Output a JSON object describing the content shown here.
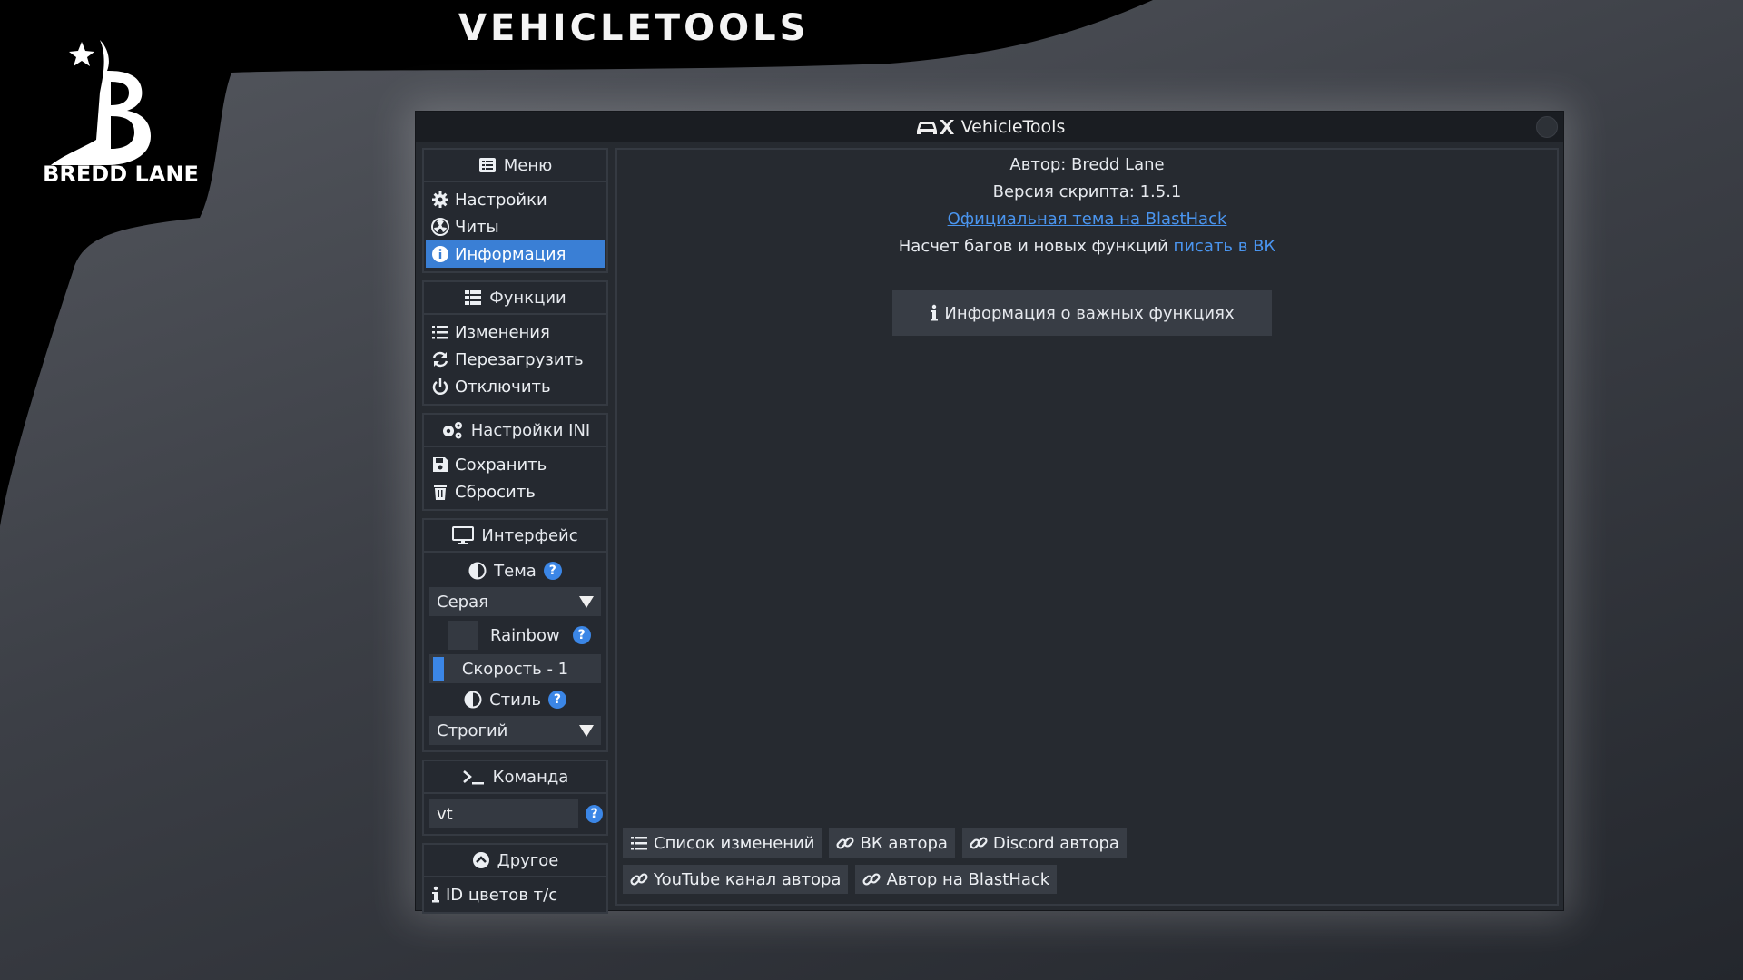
{
  "banner": {
    "title": "VEHICLETOOLS",
    "logo_text": "BREDD LANE"
  },
  "window": {
    "title": "VehicleTools"
  },
  "sidebar": {
    "menu": {
      "header": "Меню",
      "items": [
        {
          "label": "Настройки",
          "icon": "gear-icon"
        },
        {
          "label": "Читы",
          "icon": "radiation-icon"
        },
        {
          "label": "Информация",
          "icon": "info-circle-icon",
          "active": true
        }
      ]
    },
    "functions": {
      "header": "Функции",
      "items": [
        {
          "label": "Изменения",
          "icon": "list-icon"
        },
        {
          "label": "Перезагрузить",
          "icon": "refresh-icon"
        },
        {
          "label": "Отключить",
          "icon": "power-icon"
        }
      ]
    },
    "ini": {
      "header": "Настройки INI",
      "items": [
        {
          "label": "Сохранить",
          "icon": "floppy-icon"
        },
        {
          "label": "Сбросить",
          "icon": "trash-icon"
        }
      ]
    },
    "interface": {
      "header": "Интерфейс",
      "theme_label": "Тема",
      "theme_value": "Серая",
      "rainbow_label": "Rainbow",
      "rainbow_checked": false,
      "speed_label": "Скорость - 1",
      "speed_value": 1,
      "style_label": "Стиль",
      "style_value": "Строгий"
    },
    "command": {
      "header": "Команда",
      "value": "vt"
    },
    "other": {
      "header": "Другое",
      "items": [
        {
          "label": "ID цветов т/с",
          "icon": "info-icon"
        }
      ]
    }
  },
  "content": {
    "author_line": "Автор: Bredd Lane",
    "version_line": "Версия скрипта: 1.5.1",
    "forum_link": "Официальная тема на BlastHack",
    "bugs_text": "Насчет багов и новых функций",
    "bugs_link": "писать в ВК",
    "important_button": "Информация о важных функциях",
    "buttons_row1": [
      "Список изменений",
      "ВК автора",
      "Discord автора"
    ],
    "buttons_row2": [
      "YouTube канал автора",
      "Автор на BlastHack"
    ]
  },
  "colors": {
    "accent": "#3a7fd5",
    "link": "#4a95ef",
    "panel": "#262a30",
    "button": "#383d45"
  }
}
